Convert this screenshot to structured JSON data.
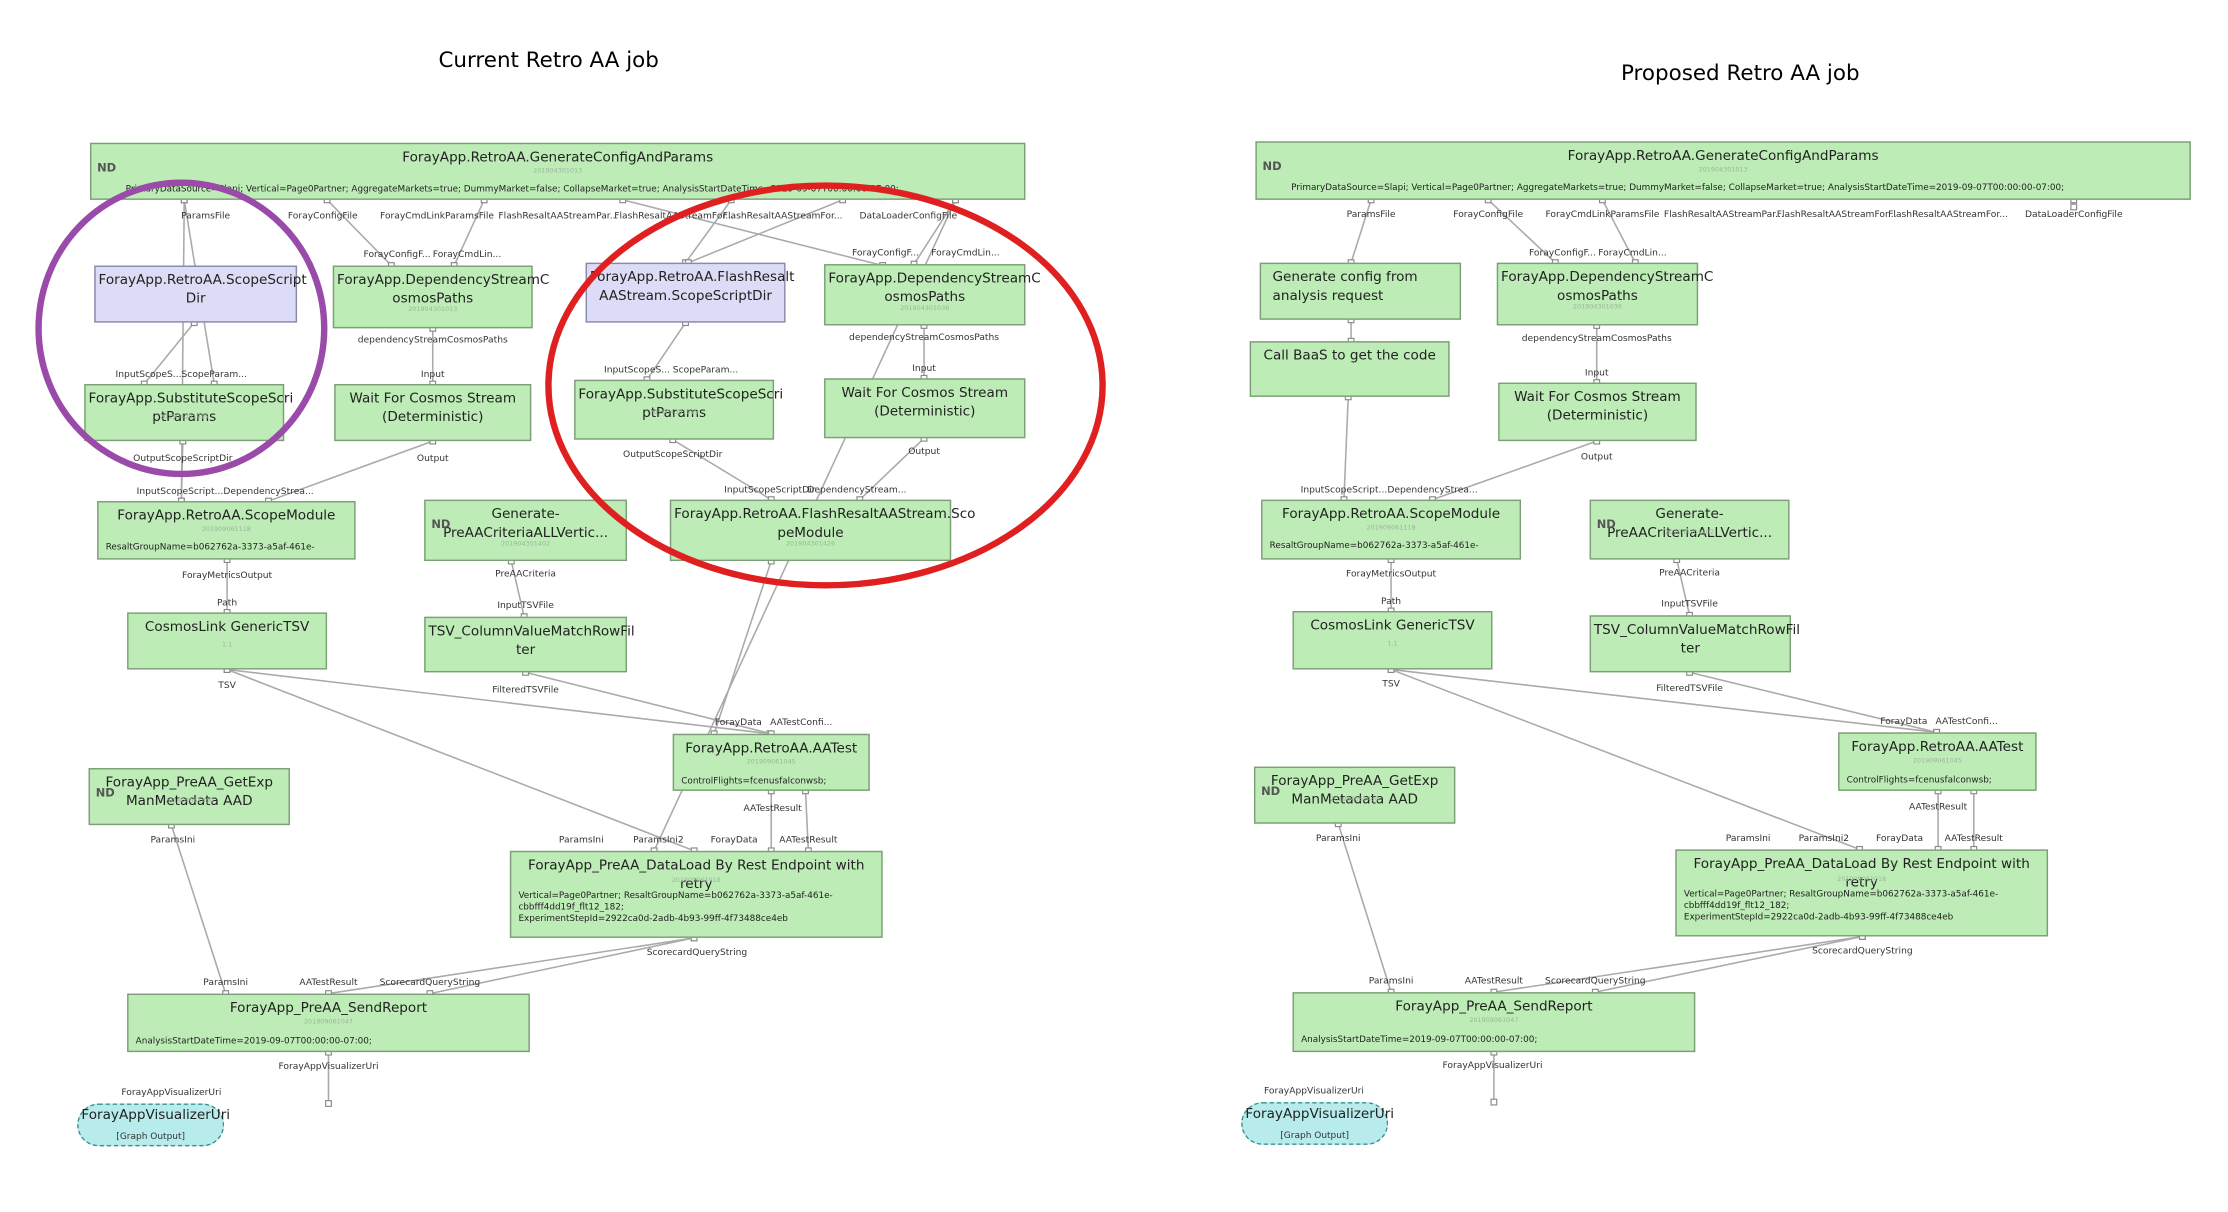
{
  "panels": [
    {
      "title": "Current Retro AA job",
      "nodes": [
        {
          "id": "gen",
          "title": "ForayApp.RetroAA.GenerateConfigAndParams",
          "nd": "ND",
          "sub": "201904301013",
          "params": "PrimaryDataSource=Slapi; Vertical=Page0Partner; AggregateMarkets=true; DummyMarket=false; CollapseMarket=true; AnalysisStartDateTime=2019-09-07T00:00:00-07:00;"
        },
        {
          "id": "ssd",
          "title": "ForayApp.RetroAA.ScopeScript Dir",
          "purple": true
        },
        {
          "id": "dsp",
          "title": "ForayApp.DependencyStreamC osmosPaths",
          "sub": "201904301013"
        },
        {
          "id": "fssd",
          "title": "ForayApp.RetroAA.FlashResalt AAStream.ScopeScriptDir",
          "purple": true
        },
        {
          "id": "dsp2",
          "title": "ForayApp.DependencyStreamC osmosPaths",
          "sub": "201904301036"
        },
        {
          "id": "ssp",
          "title": "ForayApp.SubstituteScopeScri ptParams",
          "sub": "201904301015"
        },
        {
          "id": "wcs",
          "title": "Wait For Cosmos Stream (Deterministic)"
        },
        {
          "id": "ssp2",
          "title": "ForayApp.SubstituteScopeScri ptParams",
          "sub": "201904301015"
        },
        {
          "id": "wcs2",
          "title": "Wait For Cosmos Stream (Deterministic)"
        },
        {
          "id": "sm",
          "title": "ForayApp.RetroAA.ScopeModule",
          "sub": "201909061118",
          "params": "ResaltGroupName=b062762a-3373-a5af-461e-"
        },
        {
          "id": "gpc",
          "title": "Generate-PreAACriteriaALLVertic...",
          "nd": "ND",
          "sub": "201904301402"
        },
        {
          "id": "fsm",
          "title": "ForayApp.RetroAA.FlashResaltAAStream.Sco peModule",
          "sub": "201904301426"
        },
        {
          "id": "cl",
          "title": "CosmosLink GenericTSV",
          "sub": "1.1"
        },
        {
          "id": "tsv",
          "title": "TSV_ColumnValueMatchRowFil ter"
        },
        {
          "id": "aat",
          "title": "ForayApp.RetroAA.AATest",
          "sub": "201909061045",
          "params": "ControlFlights=fcenusfalconwsb;"
        },
        {
          "id": "gem",
          "title": "ForayApp_PreAA_GetExp ManMetadata AAD",
          "nd": "ND",
          "sub": "201904061430"
        },
        {
          "id": "dl",
          "title": "ForayApp_PreAA_DataLoad By Rest Endpoint with retry",
          "sub": "201909061018",
          "params": "Vertical=Page0Partner; ResaltGroupName=b062762a-3373-a5af-461e-\ncbbfff4dd19f_flt12_182;\nExperimentStepId=2922ca0d-2adb-4b93-99ff-4f73488ce4eb"
        },
        {
          "id": "sr",
          "title": "ForayApp_PreAA_SendReport",
          "sub": "201909061047",
          "params": "AnalysisStartDateTime=2019-09-07T00:00:00-07:00;"
        },
        {
          "id": "vu",
          "title": "ForayAppVisualizerUri",
          "foot": "[Graph Output]",
          "output": true
        }
      ],
      "labels": [
        {
          "id": "l1",
          "text": "ParamsFile"
        },
        {
          "id": "l2",
          "text": "ForayConfigFile"
        },
        {
          "id": "l3",
          "text": "ForayCmdLinkParamsFile"
        },
        {
          "id": "l4",
          "text": "FlashResaltAAStreamPar..."
        },
        {
          "id": "l5",
          "text": "FlashResaltAAStreamFor..."
        },
        {
          "id": "l6",
          "text": "FlashResaltAAStreamFor..."
        },
        {
          "id": "l7",
          "text": "DataLoaderConfigFile"
        },
        {
          "id": "l8",
          "text": "ForayConfigF..."
        },
        {
          "id": "l9",
          "text": "ForayCmdLin..."
        },
        {
          "id": "l10",
          "text": "ForayConfigF..."
        },
        {
          "id": "l11",
          "text": "ForayCmdLin..."
        },
        {
          "id": "l12",
          "text": "dependencyStreamCosmosPaths"
        },
        {
          "id": "l13",
          "text": "dependencyStreamCosmosPaths"
        },
        {
          "id": "l14",
          "text": "InputScopeS..."
        },
        {
          "id": "l15",
          "text": "ScopeParam..."
        },
        {
          "id": "l16",
          "text": "Input"
        },
        {
          "id": "l17",
          "text": "InputScopeS..."
        },
        {
          "id": "l18",
          "text": "ScopeParam..."
        },
        {
          "id": "l19",
          "text": "Input"
        },
        {
          "id": "l20",
          "text": "OutputScopeScriptDir"
        },
        {
          "id": "l21",
          "text": "Output"
        },
        {
          "id": "l22",
          "text": "OutputScopeScriptDir"
        },
        {
          "id": "l23",
          "text": "Output"
        },
        {
          "id": "l24",
          "text": "InputScopeScript..."
        },
        {
          "id": "l25",
          "text": "DependencyStrea..."
        },
        {
          "id": "l26",
          "text": "PreAACriteria"
        },
        {
          "id": "l27",
          "text": "InputScopeScriptDir"
        },
        {
          "id": "l28",
          "text": "DependencyStream..."
        },
        {
          "id": "l29",
          "text": "ForayMetricsOutput"
        },
        {
          "id": "l30",
          "text": "Path"
        },
        {
          "id": "l31",
          "text": "InputTSVFile"
        },
        {
          "id": "l32",
          "text": "TSV"
        },
        {
          "id": "l33",
          "text": "FilteredTSVFile"
        },
        {
          "id": "l34",
          "text": "ForayData"
        },
        {
          "id": "l35",
          "text": "AATestConfi..."
        },
        {
          "id": "l36",
          "text": "AATestResult"
        },
        {
          "id": "l37",
          "text": "ParamsIni"
        },
        {
          "id": "l38",
          "text": "ParamsIni"
        },
        {
          "id": "l39",
          "text": "ParamsIni2"
        },
        {
          "id": "l40",
          "text": "ForayData"
        },
        {
          "id": "l41",
          "text": "AATestResult"
        },
        {
          "id": "l42",
          "text": "ScorecardQueryString"
        },
        {
          "id": "l43",
          "text": "ParamsIni"
        },
        {
          "id": "l44",
          "text": "AATestResult"
        },
        {
          "id": "l45",
          "text": "ScorecardQueryString"
        },
        {
          "id": "l46",
          "text": "ForayAppVisualizerUri"
        },
        {
          "id": "l47",
          "text": "ForayAppVisualizerUri"
        }
      ]
    },
    {
      "title": "Proposed Retro AA job",
      "nodes": [
        {
          "id": "gen",
          "title": "ForayApp.RetroAA.GenerateConfigAndParams",
          "nd": "ND",
          "sub": "201904301013",
          "params": "PrimaryDataSource=Slapi; Vertical=Page0Partner; AggregateMarkets=true; DummyMarket=false; CollapseMarket=true; AnalysisStartDateTime=2019-09-07T00:00:00-07:00;"
        },
        {
          "id": "gcr",
          "title": "Generate config from analysis request",
          "left": true
        },
        {
          "id": "dsp",
          "title": "ForayApp.DependencyStreamC osmosPaths",
          "sub": "201904301036"
        },
        {
          "id": "baas",
          "title": "Call BaaS to get the code"
        },
        {
          "id": "wcs",
          "title": "Wait For Cosmos Stream (Deterministic)"
        },
        {
          "id": "sm",
          "title": "ForayApp.RetroAA.ScopeModule",
          "sub": "201909061118",
          "params": "ResaltGroupName=b062762a-3373-a5af-461e-"
        },
        {
          "id": "gpc",
          "title": "Generate-PreAACriteriaALLVertic...",
          "nd": "ND",
          "sub": "201904301402"
        },
        {
          "id": "cl",
          "title": "CosmosLink GenericTSV",
          "sub": "1.1"
        },
        {
          "id": "tsv",
          "title": "TSV_ColumnValueMatchRowFil ter"
        },
        {
          "id": "aat",
          "title": "ForayApp.RetroAA.AATest",
          "sub": "201909061045",
          "params": "ControlFlights=fcenusfalconwsb;"
        },
        {
          "id": "gem",
          "title": "ForayApp_PreAA_GetExp ManMetadata AAD",
          "nd": "ND",
          "sub": "201904061430"
        },
        {
          "id": "dl",
          "title": "ForayApp_PreAA_DataLoad By Rest Endpoint with retry",
          "sub": "201909061018",
          "params": "Vertical=Page0Partner; ResaltGroupName=b062762a-3373-a5af-461e-\ncbbfff4dd19f_flt12_182;\nExperimentStepId=2922ca0d-2adb-4b93-99ff-4f73488ce4eb"
        },
        {
          "id": "sr",
          "title": "ForayApp_PreAA_SendReport",
          "sub": "201909061047",
          "params": "AnalysisStartDateTime=2019-09-07T00:00:00-07:00;"
        },
        {
          "id": "vu",
          "title": "ForayAppVisualizerUri",
          "foot": "[Graph Output]",
          "output": true
        }
      ],
      "labels": [
        {
          "id": "l1",
          "text": "ParamsFile"
        },
        {
          "id": "l2",
          "text": "ForayConfigFile"
        },
        {
          "id": "l3",
          "text": "ForayCmdLinkParamsFile"
        },
        {
          "id": "l4",
          "text": "FlashResaltAAStreamPar..."
        },
        {
          "id": "l5",
          "text": "FlashResaltAAStreamFor..."
        },
        {
          "id": "l6",
          "text": "FlashResaltAAStreamFor..."
        },
        {
          "id": "l7",
          "text": "DataLoaderConfigFile"
        },
        {
          "id": "l8",
          "text": "ForayConfigF..."
        },
        {
          "id": "l9",
          "text": "ForayCmdLin..."
        },
        {
          "id": "l12",
          "text": "dependencyStreamCosmosPaths"
        },
        {
          "id": "l16",
          "text": "Input"
        },
        {
          "id": "l21",
          "text": "Output"
        },
        {
          "id": "l24",
          "text": "InputScopeScript..."
        },
        {
          "id": "l25",
          "text": "DependencyStrea..."
        },
        {
          "id": "l26",
          "text": "PreAACriteria"
        },
        {
          "id": "l29",
          "text": "ForayMetricsOutput"
        },
        {
          "id": "l30",
          "text": "Path"
        },
        {
          "id": "l31",
          "text": "InputTSVFile"
        },
        {
          "id": "l32",
          "text": "TSV"
        },
        {
          "id": "l33",
          "text": "FilteredTSVFile"
        },
        {
          "id": "l34",
          "text": "ForayData"
        },
        {
          "id": "l35",
          "text": "AATestConfi..."
        },
        {
          "id": "l36",
          "text": "AATestResult"
        },
        {
          "id": "l37",
          "text": "ParamsIni"
        },
        {
          "id": "l38",
          "text": "ParamsIni"
        },
        {
          "id": "l39",
          "text": "ParamsIni2"
        },
        {
          "id": "l40",
          "text": "ForayData"
        },
        {
          "id": "l41",
          "text": "AATestResult"
        },
        {
          "id": "l42",
          "text": "ScorecardQueryString"
        },
        {
          "id": "l43",
          "text": "ParamsIni"
        },
        {
          "id": "l44",
          "text": "AATestResult"
        },
        {
          "id": "l45",
          "text": "ScorecardQueryString"
        },
        {
          "id": "l46",
          "text": "ForayAppVisualizerUri"
        },
        {
          "id": "l47",
          "text": "ForayAppVisualizerUri"
        }
      ]
    }
  ],
  "colors": {
    "node_fill": "#bdecb6",
    "node_border": "#7d9e78",
    "scope_dir_fill": "#dcdcf7",
    "output_fill": "#b8ecec",
    "edge": "#aaaaaa",
    "highlight_purple": "#9a4aa8",
    "highlight_red": "#e02020"
  }
}
